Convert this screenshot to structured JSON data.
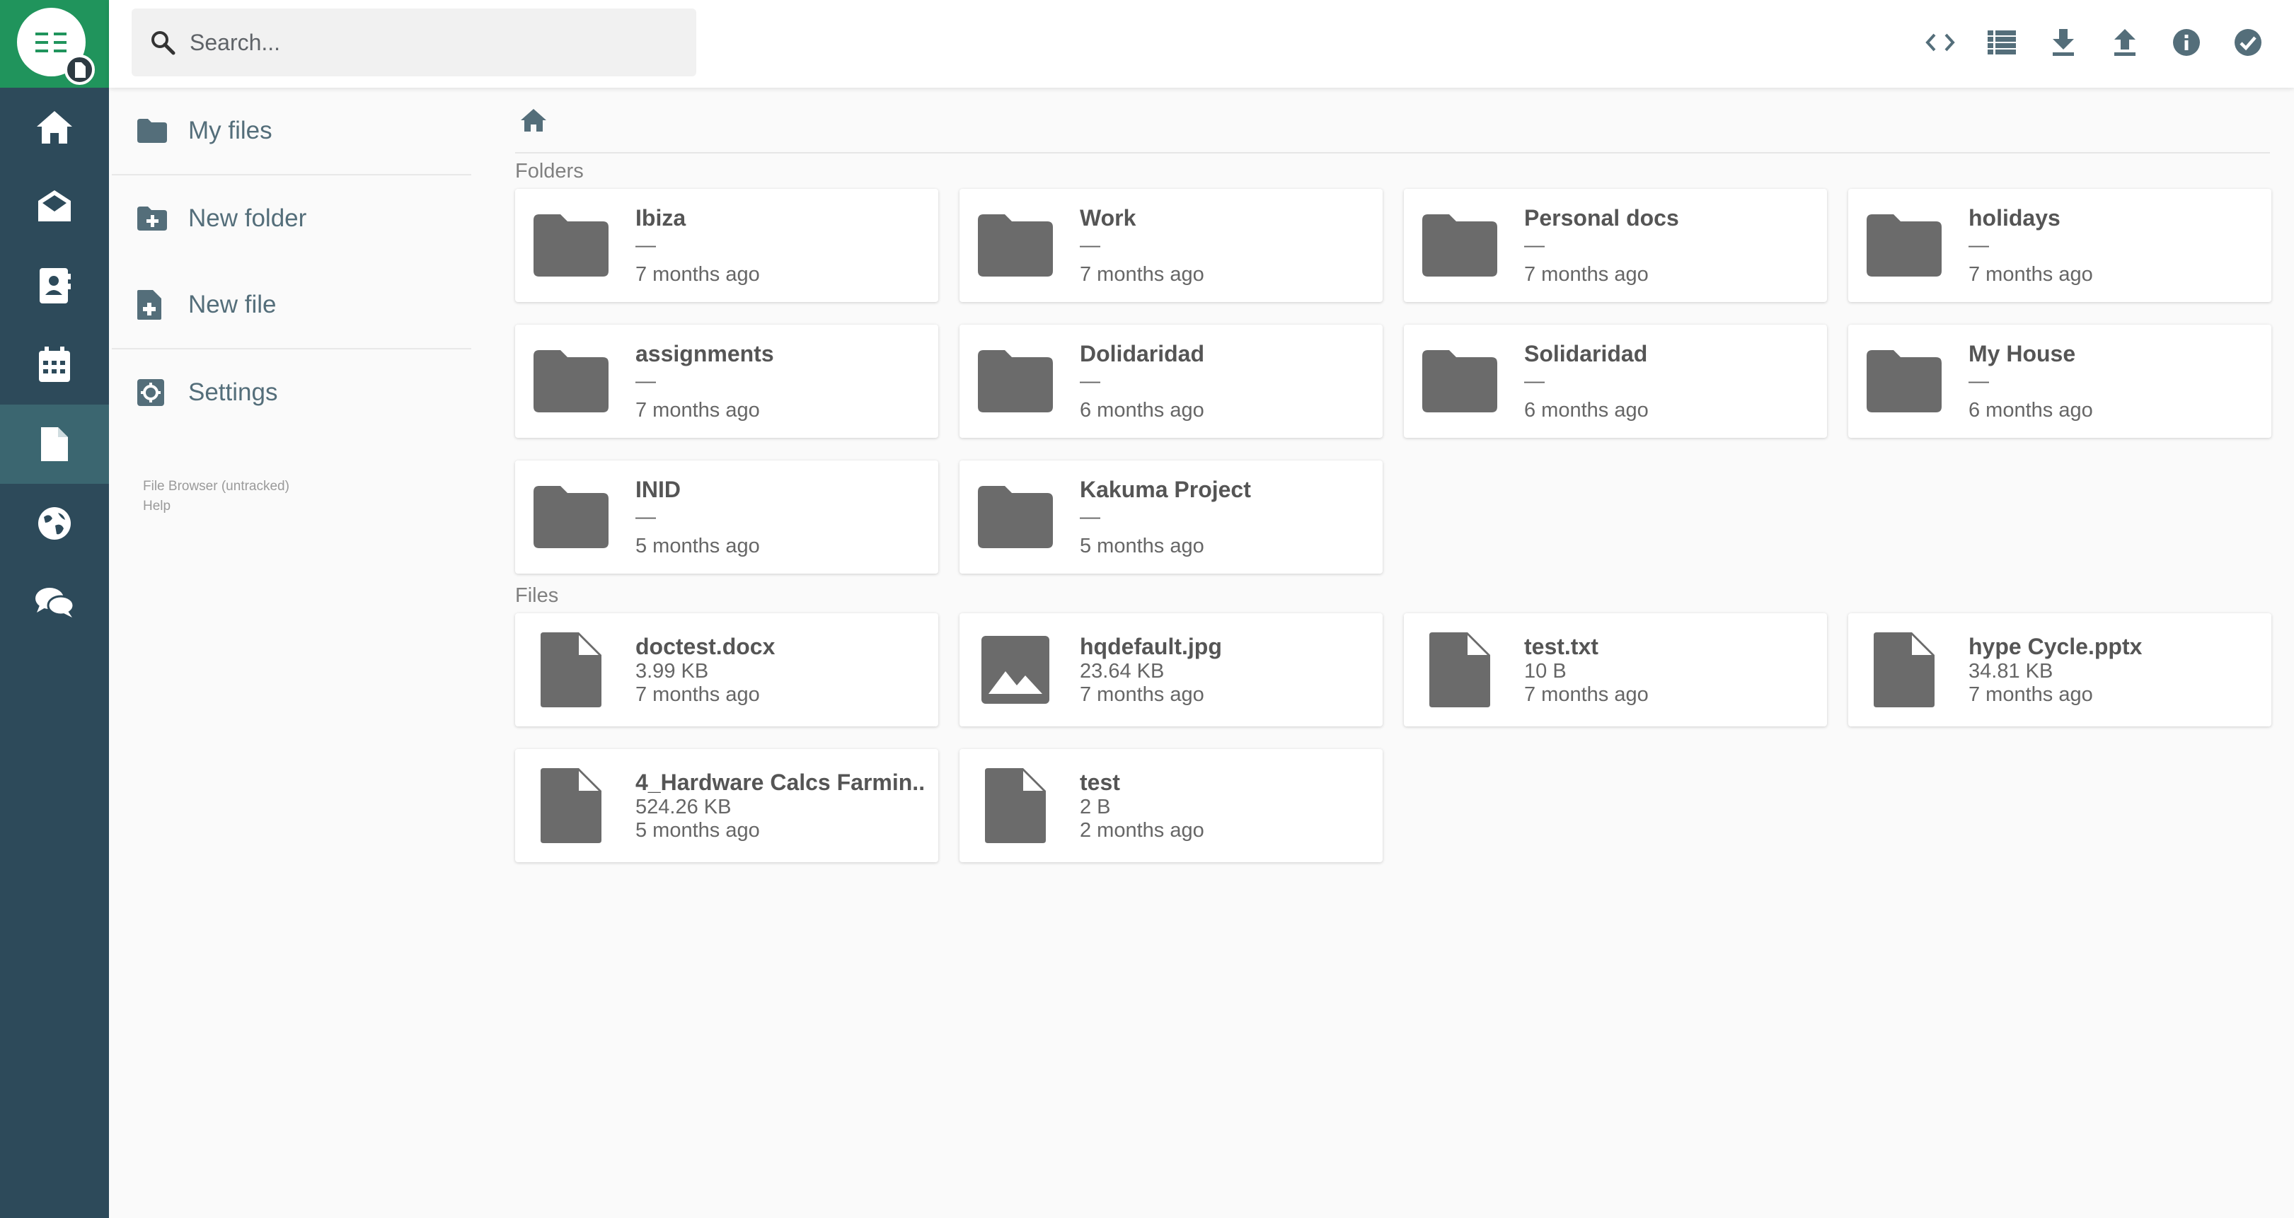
{
  "search": {
    "placeholder": "Search..."
  },
  "sidebar": {
    "items": [
      {
        "label": "My files"
      },
      {
        "label": "New folder"
      },
      {
        "label": "New file"
      },
      {
        "label": "Settings"
      }
    ],
    "footer": {
      "line1": "File Browser (untracked)",
      "line2": "Help"
    }
  },
  "sections": {
    "folders": "Folders",
    "files": "Files"
  },
  "folders": [
    {
      "name": "Ibiza",
      "size": "—",
      "modified": "7 months ago"
    },
    {
      "name": "Work",
      "size": "—",
      "modified": "7 months ago"
    },
    {
      "name": "Personal docs",
      "size": "—",
      "modified": "7 months ago"
    },
    {
      "name": "holidays",
      "size": "—",
      "modified": "7 months ago"
    },
    {
      "name": "assignments",
      "size": "—",
      "modified": "7 months ago"
    },
    {
      "name": "Dolidaridad",
      "size": "—",
      "modified": "6 months ago"
    },
    {
      "name": "Solidaridad",
      "size": "—",
      "modified": "6 months ago"
    },
    {
      "name": "My House",
      "size": "—",
      "modified": "6 months ago"
    },
    {
      "name": "INID",
      "size": "—",
      "modified": "5 months ago"
    },
    {
      "name": "Kakuma Project",
      "size": "—",
      "modified": "5 months ago"
    }
  ],
  "files": [
    {
      "name": "doctest.docx",
      "size": "3.99 KB",
      "modified": "7 months ago",
      "icon": "file-icon"
    },
    {
      "name": "hqdefault.jpg",
      "size": "23.64 KB",
      "modified": "7 months ago",
      "icon": "image-icon"
    },
    {
      "name": "test.txt",
      "size": "10 B",
      "modified": "7 months ago",
      "icon": "file-icon"
    },
    {
      "name": "hype Cycle.pptx",
      "size": "34.81 KB",
      "modified": "7 months ago",
      "icon": "file-icon"
    },
    {
      "name": "4_Hardware Calcs Farmin...",
      "size": "524.26 KB",
      "modified": "5 months ago",
      "icon": "file-icon"
    },
    {
      "name": "test",
      "size": "2 B",
      "modified": "2 months ago",
      "icon": "file-icon"
    }
  ],
  "colors": {
    "rail": "#2d4a5a",
    "brand": "#20945c",
    "rail_active": "#3b6670",
    "icon": "#546e7a",
    "item_icon": "#666666"
  }
}
